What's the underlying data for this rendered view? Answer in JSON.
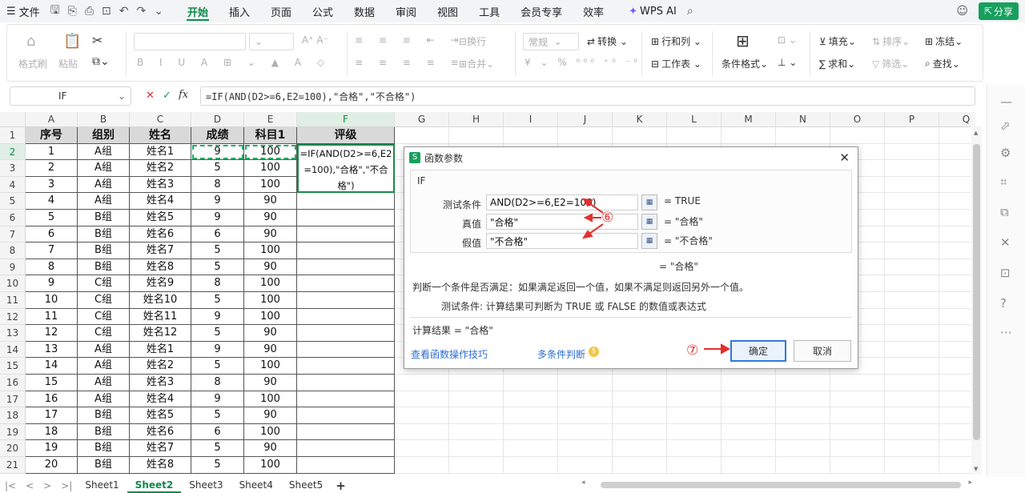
{
  "menubar": {
    "file": "文件",
    "tabs": [
      "开始",
      "插入",
      "页面",
      "公式",
      "数据",
      "审阅",
      "视图",
      "工具",
      "会员专享",
      "效率"
    ],
    "wps_ai": "WPS AI",
    "share": "分享"
  },
  "ribbon": {
    "format_painter": "格式刷",
    "paste": "粘贴",
    "wrap": "换行",
    "number_format": "常规",
    "convert": "转换",
    "row_col": "行和列",
    "worksheet": "工作表",
    "cond_format": "条件格式",
    "merge": "合并",
    "fill": "填充",
    "sort": "排序",
    "freeze": "冻结",
    "sum": "求和",
    "filter": "筛选",
    "find": "查找"
  },
  "formula_bar": {
    "name_box": "IF",
    "formula": "=IF(AND(D2>=6,E2=100),\"合格\",\"不合格\")"
  },
  "columns": [
    "A",
    "B",
    "C",
    "D",
    "E",
    "F",
    "G",
    "H",
    "I",
    "J",
    "K",
    "L",
    "M",
    "N",
    "O",
    "P",
    "Q"
  ],
  "rows": [
    "1",
    "2",
    "3",
    "4",
    "5",
    "6",
    "7",
    "8",
    "9",
    "10",
    "11",
    "12",
    "13",
    "14",
    "15",
    "16",
    "17",
    "18",
    "19",
    "20",
    "21"
  ],
  "table": {
    "headers": [
      "序号",
      "组别",
      "姓名",
      "成绩",
      "科目1",
      "评级"
    ],
    "data": [
      [
        "1",
        "A组",
        "姓名1",
        "9",
        "100"
      ],
      [
        "2",
        "A组",
        "姓名2",
        "5",
        "100"
      ],
      [
        "3",
        "A组",
        "姓名3",
        "8",
        "100"
      ],
      [
        "4",
        "A组",
        "姓名4",
        "9",
        "90"
      ],
      [
        "5",
        "B组",
        "姓名5",
        "9",
        "90"
      ],
      [
        "6",
        "B组",
        "姓名6",
        "6",
        "90"
      ],
      [
        "7",
        "B组",
        "姓名7",
        "5",
        "100"
      ],
      [
        "8",
        "B组",
        "姓名8",
        "5",
        "90"
      ],
      [
        "9",
        "C组",
        "姓名9",
        "8",
        "100"
      ],
      [
        "10",
        "C组",
        "姓名10",
        "5",
        "100"
      ],
      [
        "11",
        "C组",
        "姓名11",
        "9",
        "100"
      ],
      [
        "12",
        "C组",
        "姓名12",
        "5",
        "90"
      ],
      [
        "13",
        "A组",
        "姓名1",
        "9",
        "90"
      ],
      [
        "14",
        "A组",
        "姓名2",
        "5",
        "100"
      ],
      [
        "15",
        "A组",
        "姓名3",
        "8",
        "90"
      ],
      [
        "16",
        "A组",
        "姓名4",
        "9",
        "100"
      ],
      [
        "17",
        "B组",
        "姓名5",
        "5",
        "90"
      ],
      [
        "18",
        "B组",
        "姓名6",
        "6",
        "100"
      ],
      [
        "19",
        "B组",
        "姓名7",
        "5",
        "90"
      ],
      [
        "20",
        "B组",
        "姓名8",
        "5",
        "100"
      ]
    ],
    "f2_lines": [
      "=IF(AND(D2>=6,E2",
      "=100),\"合格\",\"不合",
      "格\")"
    ]
  },
  "sheets": [
    "Sheet1",
    "Sheet2",
    "Sheet3",
    "Sheet4",
    "Sheet5"
  ],
  "dialog": {
    "title": "函数参数",
    "func": "IF",
    "test_label": "测试条件",
    "test_value": "AND(D2>=6,E2=100)",
    "test_result": "= TRUE",
    "true_label": "真值",
    "true_value": "\"合格\"",
    "true_result": "= \"合格\"",
    "false_label": "假值",
    "false_value": "\"不合格\"",
    "false_result": "= \"不合格\"",
    "overall_result": "= \"合格\"",
    "description": "判断一个条件是否满足：如果满足返回一个值，如果不满足则返回另外一个值。",
    "param_desc": "测试条件:  计算结果可判断为 TRUE 或 FALSE 的数值或表达式",
    "calc_result": "计算结果 =  \"合格\"",
    "link_tips": "查看函数操作技巧",
    "link_multi": "多条件判断",
    "ok": "确定",
    "cancel": "取消",
    "ann6": "⑥",
    "ann7": "⑦"
  },
  "colors": {
    "accent": "#0d8a4a",
    "share_bg": "#17a05d",
    "annotation": "#e23030",
    "link": "#2b6cd6",
    "header_fill": "#d9d9d9"
  }
}
